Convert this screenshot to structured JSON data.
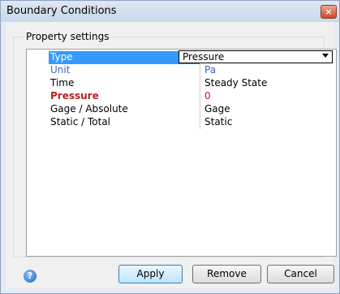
{
  "window": {
    "title": "Boundary Conditions",
    "close_glyph": "×"
  },
  "group": {
    "label": "Property settings"
  },
  "properties": [
    {
      "name": "Type",
      "value": "Pressure"
    },
    {
      "name": "Unit",
      "value": "Pa"
    },
    {
      "name": "Time",
      "value": "Steady State"
    },
    {
      "name": "Pressure",
      "value": "0"
    },
    {
      "name": "Gage / Absolute",
      "value": "Gage"
    },
    {
      "name": "Static / Total",
      "value": "Static"
    }
  ],
  "buttons": {
    "apply": "Apply",
    "remove": "Remove",
    "cancel": "Cancel"
  },
  "help": {
    "glyph": "?"
  },
  "colors": {
    "selection": "#3399ff",
    "unit_text": "#3c64c8",
    "required_text": "#b22222"
  }
}
